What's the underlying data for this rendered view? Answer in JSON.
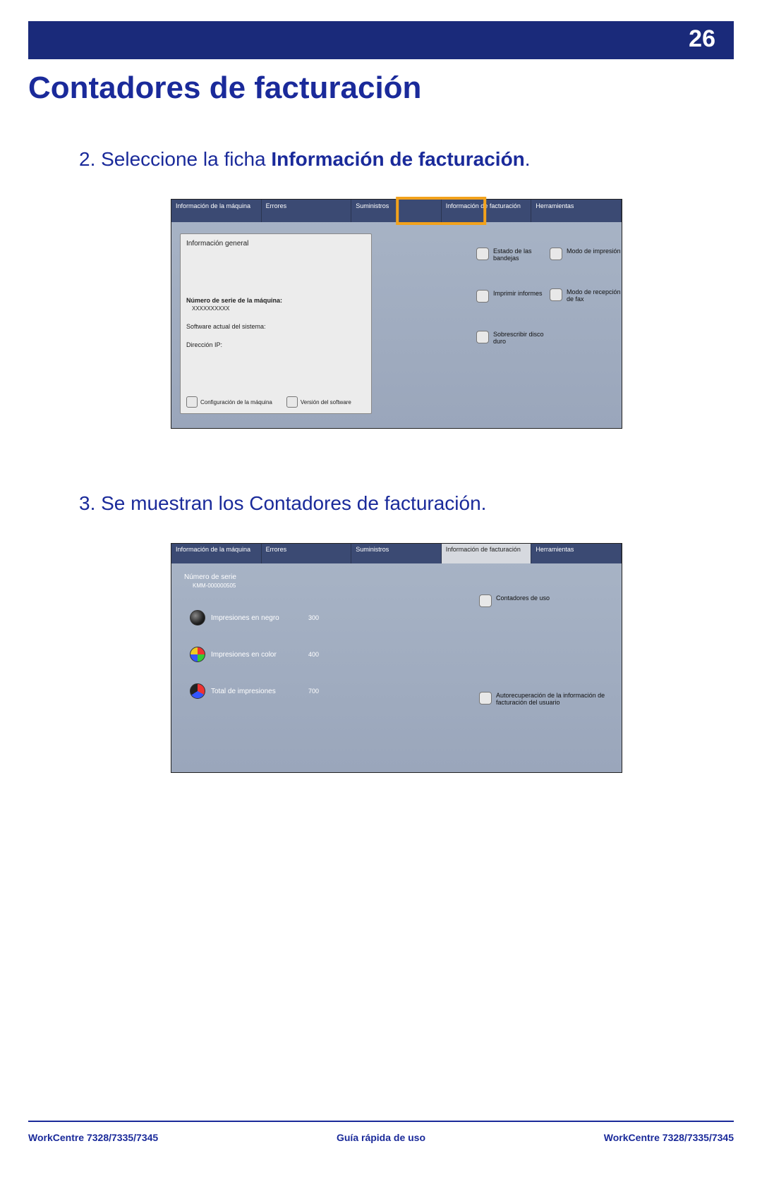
{
  "page": {
    "number": "26",
    "title": "Contadores de facturación"
  },
  "step2": {
    "prefix": "2. Seleccione la ficha ",
    "bold": "Información de facturación",
    "suffix": "."
  },
  "step3": {
    "text": "3. Se muestran los Contadores de facturación."
  },
  "shot1": {
    "tabs": {
      "t0": "Información de la máquina",
      "t1": "Errores",
      "t2": "Suministros",
      "t3": "Información de facturación",
      "t4": "Herramientas"
    },
    "left": {
      "heading": "Información general",
      "serial_label": "Número de serie de la máquina:",
      "serial_val": "XXXXXXXXXX",
      "software": "Software actual del sistema:",
      "ip": "Dirección IP:",
      "btn1": "Configuración de la máquina",
      "btn2": "Versión del software"
    },
    "rightA": {
      "o0": "Estado de las bandejas",
      "o1": "Imprimir informes",
      "o2": "Sobrescribir disco duro"
    },
    "rightB": {
      "o0": "Modo de impresión",
      "o1": "Modo de recepción de fax"
    }
  },
  "shot2": {
    "tabs": {
      "t0": "Información de la máquina",
      "t1": "Errores",
      "t2": "Suministros",
      "t3": "Información de facturación",
      "t4": "Herramientas"
    },
    "serial_label": "Número de serie",
    "serial_val": "KMM-000000505",
    "meters": {
      "m0l": "Impresiones en negro",
      "m0v": "300",
      "m1l": "Impresiones en color",
      "m1v": "400",
      "m2l": "Total de impresiones",
      "m2v": "700"
    },
    "right": {
      "o0": "Contadores de uso",
      "o1": "Autorecuperación de la información de facturación del usuario"
    }
  },
  "footer": {
    "left": "WorkCentre 7328/7335/7345",
    "center": "Guía rápida de uso",
    "right": "WorkCentre 7328/7335/7345"
  }
}
